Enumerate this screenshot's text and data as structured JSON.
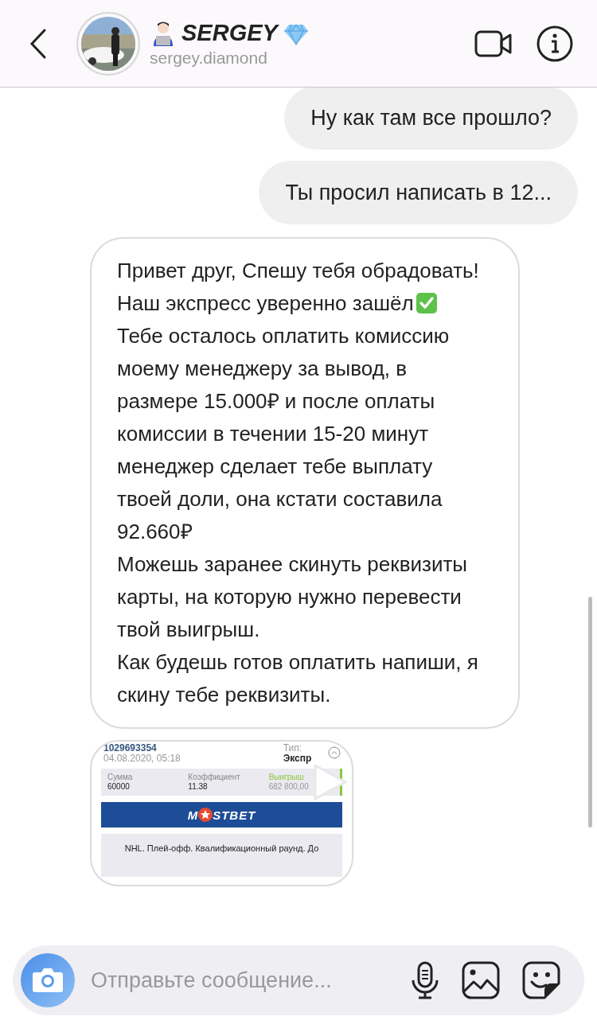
{
  "header": {
    "name": "SERGEY",
    "username": "sergey.diamond"
  },
  "messages": [
    {
      "kind": "sent",
      "text": "Ну как там все прошло?"
    },
    {
      "kind": "sent",
      "text": "Ты просил написать в 12..."
    },
    {
      "kind": "received",
      "paragraphs": [
        {
          "text": "Привет друг, Спешу тебя обрадовать!",
          "check": false
        },
        {
          "text": "Наш экспресс уверенно зашёл",
          "check": true
        },
        {
          "text": "Тебе осталось оплатить комиссию моему менеджеру за вывод, в размере 15.000₽ и после оплаты комиссии в течении 15-20 минут  менеджер сделает тебе выплату твоей доли, она кстати составила 92.660₽",
          "check": false
        },
        {
          "text": "Можешь заранее скинуть реквизиты карты, на которую нужно перевести твой выигрыш.",
          "check": false
        },
        {
          "text": "Как будешь готов оплатить напиши, я скину тебе реквизиты.",
          "check": false
        }
      ]
    },
    {
      "kind": "screenshot",
      "bet_number": "1029693354",
      "date": "04.08.2020, 05:18",
      "type_label": "Тип:",
      "type_value": "Экспр",
      "stats": [
        {
          "label": "Сумма",
          "value": "60000",
          "highlight": false
        },
        {
          "label": "Коэффициент",
          "value": "11.38",
          "highlight": false
        },
        {
          "label": "Выигрыш",
          "value": "682 800,00",
          "highlight": true
        }
      ],
      "logo_left": "M",
      "logo_right": "STBET",
      "event": "NHL. Плей-офф. Квалификационный раунд. До"
    }
  ],
  "composer": {
    "placeholder": "Отправьте сообщение..."
  }
}
